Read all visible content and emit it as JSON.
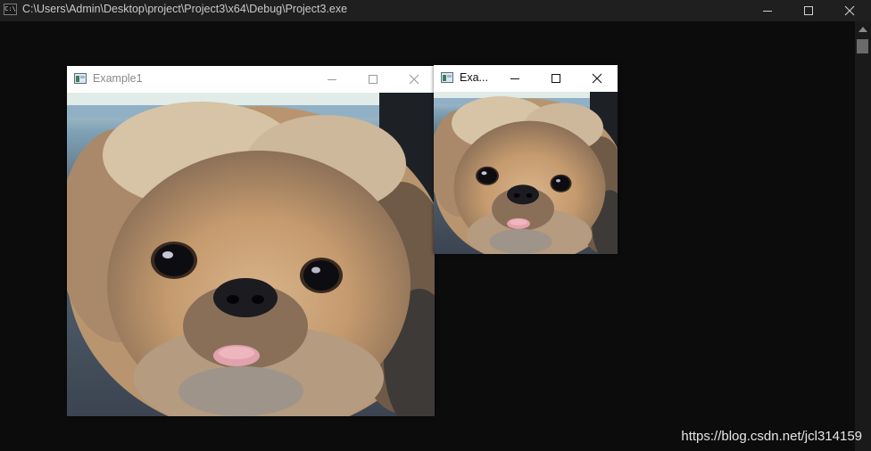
{
  "console": {
    "icon_text": "C:\\",
    "title": "C:\\Users\\Admin\\Desktop\\project\\Project3\\x64\\Debug\\Project3.exe"
  },
  "windows": [
    {
      "title": "Example1"
    },
    {
      "title": "Exa..."
    }
  ],
  "watermark": "https://blog.csdn.net/jcl314159",
  "colors": {
    "console_bg": "#0c0c0c",
    "console_titlebar": "#1f1f1f",
    "window_bg": "#ffffff"
  },
  "images": [
    {
      "description_icon": "pekingese-dog-photo"
    },
    {
      "description_icon": "pekingese-dog-photo-small"
    }
  ]
}
